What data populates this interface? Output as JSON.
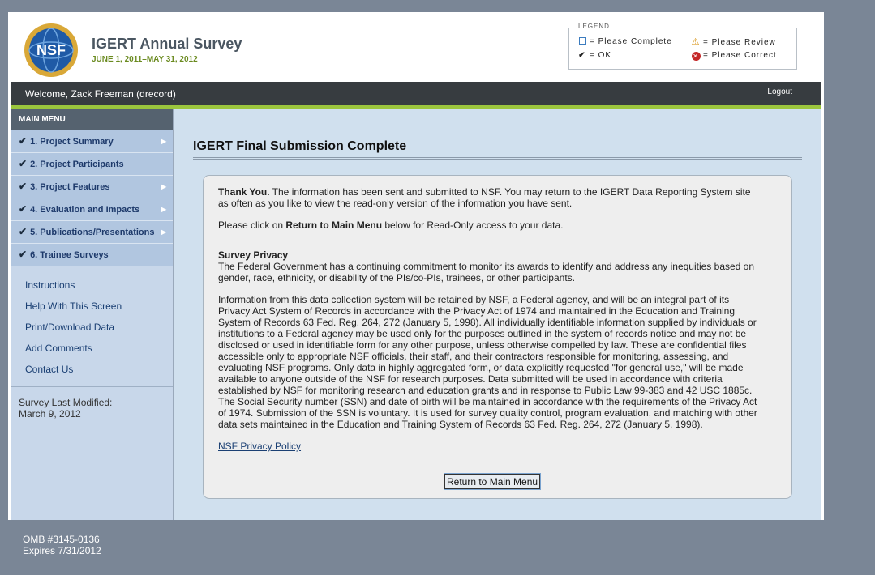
{
  "header": {
    "title": "IGERT Annual Survey",
    "dates": "JUNE 1, 2011–MAY 31, 2012",
    "logo_text": "NSF"
  },
  "legend": {
    "title": "LEGEND",
    "please_complete": "= Please Complete",
    "please_review": "= Please Review",
    "ok": "= OK",
    "please_correct": "= Please Correct"
  },
  "welcome_bar": {
    "welcome": "Welcome, Zack Freeman (drecord)",
    "logout": "Logout"
  },
  "sidebar": {
    "menu_title": "MAIN MENU",
    "items": [
      {
        "label": "1. Project Summary"
      },
      {
        "label": "2. Project Participants"
      },
      {
        "label": "3. Project Features"
      },
      {
        "label": "4. Evaluation and Impacts"
      },
      {
        "label": "5. Publications/Presentations"
      },
      {
        "label": "6. Trainee Surveys"
      }
    ],
    "links": [
      {
        "label": "Instructions"
      },
      {
        "label": "Help With This Screen"
      },
      {
        "label": "Print/Download Data"
      },
      {
        "label": "Add Comments"
      },
      {
        "label": "Contact Us"
      }
    ],
    "last_modified_label": "Survey Last Modified:",
    "last_modified_date": "March 9, 2012"
  },
  "main": {
    "title": "IGERT Final Submission Complete",
    "thank_you_bold": "Thank You.",
    "thank_you_text": " The information has been sent and submitted to NSF. You may return to the IGERT Data Reporting System site as often as you like to view the read-only version of the information you have sent.",
    "click_pre": "Please click on ",
    "click_bold": "Return to Main Menu",
    "click_post": " below for Read-Only access to your data.",
    "privacy_heading": "Survey Privacy",
    "privacy_p1": "The Federal Government has a continuing commitment to monitor its awards to identify and address any inequities based on gender, race, ethnicity, or disability of the PIs/co-PIs, trainees, or other participants.",
    "privacy_p2": "Information from this data collection system will be retained by NSF, a Federal agency, and will be an integral part of its Privacy Act System of Records in accordance with the Privacy Act of 1974 and maintained in the Education and Training System of Records 63 Fed. Reg. 264, 272 (January 5, 1998). All individually identifiable information supplied by individuals or institutions to a Federal agency may be used only for the purposes outlined in the system of records notice and may not be disclosed or used in identifiable form for any other purpose, unless otherwise compelled by law. These are confidential files accessible only to appropriate NSF officials, their staff, and their contractors responsible for monitoring, assessing, and evaluating NSF programs. Only data in highly aggregated form, or data explicitly requested \"for general use,\" will be made available to anyone outside of the NSF for research purposes. Data submitted will be used in accordance with criteria established by NSF for monitoring research and education grants and in response to Public Law 99-383 and 42 USC 1885c. The Social Security number (SSN) and date of birth will be maintained in accordance with the requirements of the Privacy Act of 1974. Submission of the SSN is voluntary. It is used for survey quality control, program evaluation, and matching with other data sets maintained in the Education and Training System of Records 63 Fed. Reg. 264, 272 (January 5, 1998).",
    "privacy_link": "NSF Privacy Policy",
    "return_button": "Return to Main Menu"
  },
  "footer": {
    "omb": "OMB #3145-0136",
    "expires": "Expires 7/31/2012"
  },
  "colors": {
    "accent_green": "#9bc53d",
    "sidebar_bg": "#c8d7ea",
    "content_bg": "#d0e0ee"
  }
}
